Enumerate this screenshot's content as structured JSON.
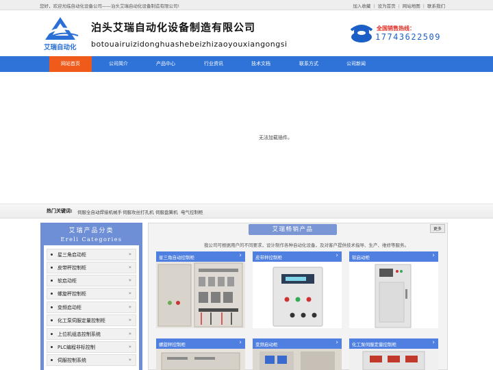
{
  "topbar": {
    "welcome": "您好，欢迎光临自动化设备公司——泊头艾瑞自动化设备制造有限公司!",
    "links": [
      "加入收藏",
      "设为首页",
      "网站地图",
      "联系我们"
    ]
  },
  "header": {
    "logo_text": "艾瑞自动化",
    "company_name": "泊头艾瑞自动化设备制造有限公司",
    "company_pinyin": "botouairuizidonghuashebeizhizaoyouxiangongsi",
    "hotline_label": "全国销售热线：",
    "hotline_number": "17743622509"
  },
  "nav": {
    "items": [
      "网站首页",
      "公司简介",
      "产品中心",
      "行业资讯",
      "技术文档",
      "联系方式",
      "公司新闻"
    ],
    "active": "网站首页"
  },
  "banner": {
    "plugin_message": "无法加载插件。"
  },
  "hotwords": {
    "label": "热门关键词:",
    "items": [
      "伺服全自动焊接机械手",
      "伺服攻丝打孔机",
      "伺服盘簧机",
      "电气控制柜"
    ]
  },
  "sidebar": {
    "title": "艾瑞产品分类",
    "subtitle": "Ereli Categories",
    "items": [
      "星三角启动柜",
      "皮带秤控制柜",
      "软启动柜",
      "螺旋秤控制柜",
      "变频启动柜",
      "化工泵伺服定量控制柜",
      "上位机组态控制系统",
      "PLC编程非标控制",
      "伺服控制系统"
    ]
  },
  "products": {
    "title": "艾瑞畅销产品",
    "more": "更多",
    "description": "我公司可根据用户的不同要求，设计制作各种自动化设备，及对客户提供技术指导、生产、维修等服务。",
    "cards": [
      "星三角自动控制柜",
      "皮带秤控制柜",
      "软启动柜",
      "螺旋秤控制柜",
      "变频启动柜",
      "化工泵伺服定量控制柜"
    ]
  },
  "colors": {
    "nav_bg": "#2f73d9",
    "nav_active": "#f05a1a",
    "sidebar_bg": "#6e8fd6",
    "card_header": "#4f7fe0",
    "hotline_label": "#e5281f",
    "hotline_number": "#1b5fc7"
  }
}
